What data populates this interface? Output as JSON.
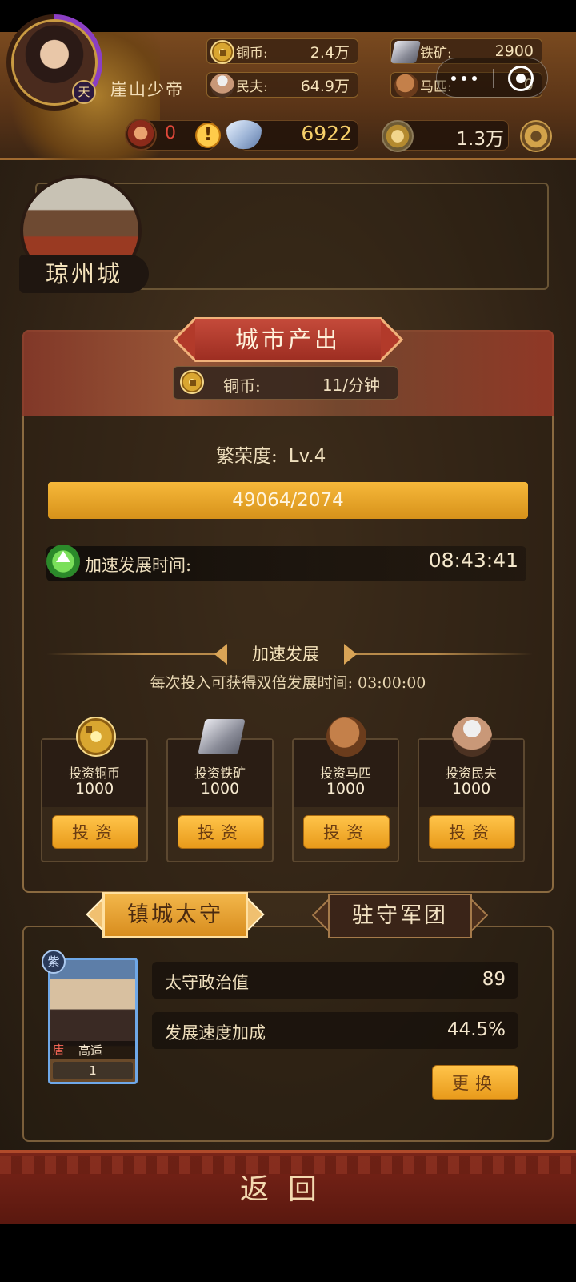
{
  "player": {
    "name": "崖山少帝",
    "title_badge": "天"
  },
  "resources": {
    "copper": {
      "label": "铜币:",
      "value": "2.4万"
    },
    "iron": {
      "label": "铁矿:",
      "value": "2900"
    },
    "labor": {
      "label": "民夫:",
      "value": "64.9万"
    },
    "horse": {
      "label": "马匹:",
      "value": "0"
    },
    "warrior_count": "0",
    "alert": "!",
    "silver": "6922",
    "jade": "1.3万"
  },
  "city": {
    "name": "琼州城"
  },
  "output": {
    "title": "城市产出",
    "copper_label": "铜币:",
    "copper_rate": "11/分钟",
    "prosperity_label": "繁荣度:",
    "prosperity_level": "Lv.4",
    "progress_text": "49064/2074",
    "progress_fraction": 1.0,
    "speed_label": "加速发展时间:",
    "speed_time": "08:43:41"
  },
  "accelerate": {
    "title": "加速发展",
    "desc": "每次投入可获得双倍发展时间: 03:00:00",
    "cards": [
      {
        "name": "投资铜币",
        "amount": "1000",
        "button": "投资",
        "icon": "coin-icon"
      },
      {
        "name": "投资铁矿",
        "amount": "1000",
        "button": "投资",
        "icon": "iron-icon"
      },
      {
        "name": "投资马匹",
        "amount": "1000",
        "button": "投资",
        "icon": "horse-icon"
      },
      {
        "name": "投资民夫",
        "amount": "1000",
        "button": "投资",
        "icon": "laborer-icon"
      }
    ]
  },
  "governor": {
    "tab_active": "镇城太守",
    "tab_other": "驻守军团",
    "hero": {
      "rank": "紫",
      "dynasty": "唐",
      "name": "高适",
      "level": "1"
    },
    "stats": [
      {
        "label": "太守政治值",
        "value": "89"
      },
      {
        "label": "发展速度加成",
        "value": "44.5%"
      }
    ],
    "swap_button": "更换"
  },
  "footer": {
    "back": "返回"
  }
}
